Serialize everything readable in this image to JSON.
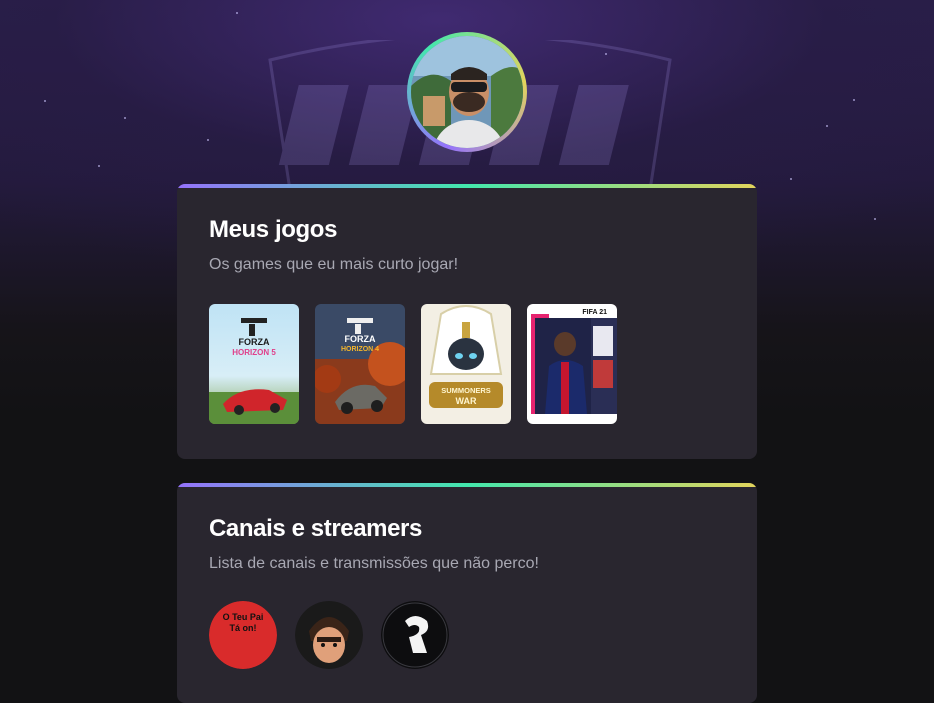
{
  "profile": {
    "avatar_icon": "profile-photo-man-with-sunglasses"
  },
  "games_section": {
    "title": "Meus jogos",
    "subtitle": "Os games que eu mais curto jogar!",
    "items": [
      {
        "name": "Forza Horizon 5",
        "cover_text": [
          "FORZA",
          "HORIZON 5"
        ]
      },
      {
        "name": "Forza Horizon 4",
        "cover_text": [
          "FORZA",
          "HORIZON 4"
        ]
      },
      {
        "name": "Summoners War",
        "cover_text": [
          "SUMMONERS",
          "WAR"
        ]
      },
      {
        "name": "FIFA 21",
        "cover_text": [
          "FIFA 21"
        ]
      }
    ]
  },
  "streamers_section": {
    "title": "Canais e streamers",
    "subtitle": "Lista de canais e transmissões que não perco!",
    "items": [
      {
        "name": "O Teu Pai Tá on!",
        "label_lines": [
          "O Teu Pai",
          "Tá on!"
        ]
      },
      {
        "name": "streamer-cartoon-avatar"
      },
      {
        "name": "streamer-black-logo"
      }
    ]
  },
  "colors": {
    "card_bg": "#29262f",
    "accent_gradient": [
      "#9572fc",
      "#43e7ad",
      "#e2d45c"
    ],
    "title": "#ffffff",
    "subtitle": "#a8a8b3"
  }
}
